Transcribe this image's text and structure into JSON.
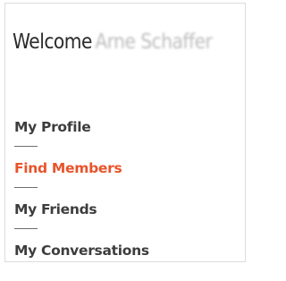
{
  "welcome": {
    "greeting": "Welcome",
    "user_name": "Arne Schaffer"
  },
  "menu": {
    "items": [
      {
        "label": "My Profile",
        "active": false
      },
      {
        "label": "Find Members",
        "active": true
      },
      {
        "label": "My Friends",
        "active": false
      },
      {
        "label": "My Conversations",
        "active": false
      }
    ]
  },
  "colors": {
    "active": "#e8542b",
    "text": "#3d3d3d",
    "border": "#dcdcdc"
  }
}
